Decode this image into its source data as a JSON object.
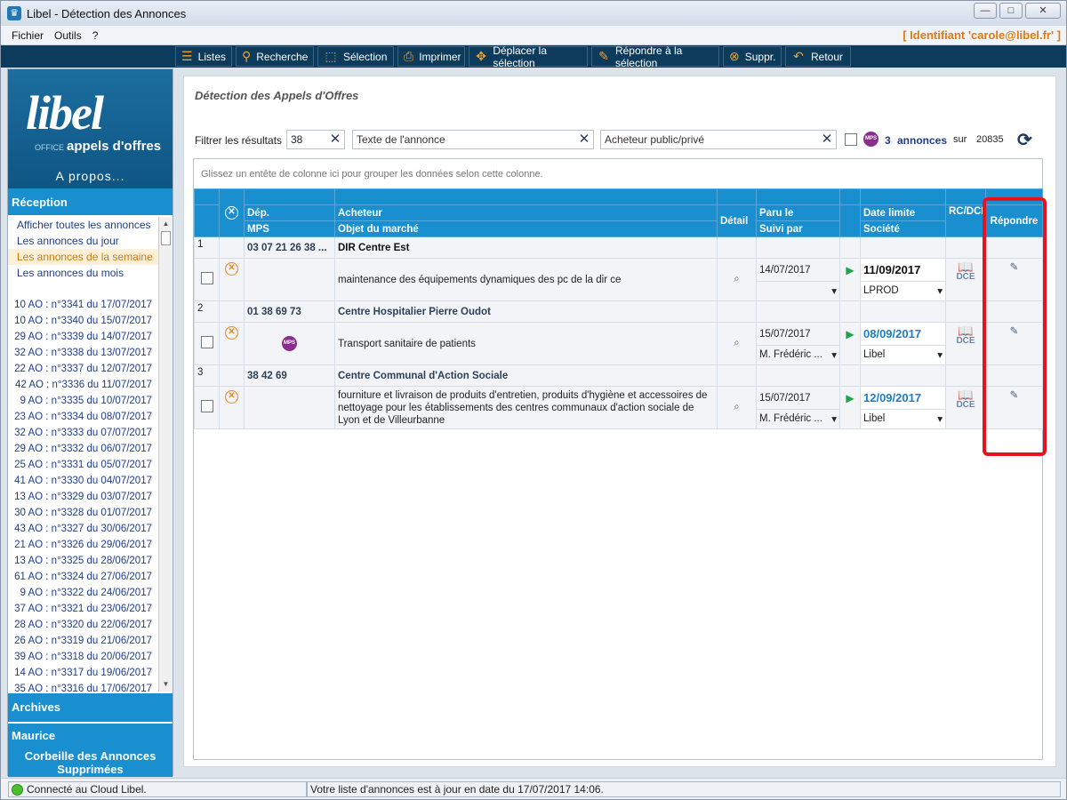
{
  "window": {
    "title": "Libel - Détection des Annonces",
    "controls": {
      "minimize": "—",
      "maximize": "□",
      "close": "✕"
    }
  },
  "menu": {
    "items": [
      "Fichier",
      "Outils",
      "?"
    ],
    "identity": "[ Identifiant 'carole@libel.fr' ]"
  },
  "toolbar": {
    "buttons": [
      {
        "label": "Listes",
        "icon": "list-icon"
      },
      {
        "label": "Recherche",
        "icon": "search-icon"
      },
      {
        "label": "Sélection",
        "icon": "selection-icon"
      },
      {
        "label": "Imprimer",
        "icon": "printer-icon"
      },
      {
        "label": "Déplacer la sélection",
        "icon": "move-icon"
      },
      {
        "label": "Répondre à la sélection",
        "icon": "edit-icon"
      },
      {
        "label": "Suppr.",
        "icon": "cancel-icon"
      },
      {
        "label": "Retour",
        "icon": "back-icon"
      }
    ]
  },
  "sidebar": {
    "logo": {
      "word": "libel",
      "office": "OFFICE",
      "sub": "appels d'offres"
    },
    "apropos": "A propos...",
    "reception": "Réception",
    "nav": [
      "Afficher toutes les annonces",
      "Les annonces du jour",
      "Les annonces de la semaine",
      "Les annonces du mois"
    ],
    "ao": [
      "10 AO : n°3341 du 17/07/2017",
      "10 AO : n°3340 du 15/07/2017",
      "29 AO : n°3339 du 14/07/2017",
      "32 AO : n°3338 du 13/07/2017",
      "22 AO : n°3337 du 12/07/2017",
      "42 AO : n°3336 du 11/07/2017",
      "9 AO : n°3335 du 10/07/2017",
      "23 AO : n°3334 du 08/07/2017",
      "32 AO : n°3333 du 07/07/2017",
      "29 AO : n°3332 du 06/07/2017",
      "25 AO : n°3331 du 05/07/2017",
      "41 AO : n°3330 du 04/07/2017",
      "13 AO : n°3329 du 03/07/2017",
      "30 AO : n°3328 du 01/07/2017",
      "43 AO : n°3327 du 30/06/2017",
      "21 AO : n°3326 du 29/06/2017",
      "13 AO : n°3325 du 28/06/2017",
      "61 AO : n°3324 du 27/06/2017",
      "9 AO : n°3322 du 24/06/2017",
      "37 AO : n°3321 du 23/06/2017",
      "28 AO : n°3320 du 22/06/2017",
      "26 AO : n°3319 du 21/06/2017",
      "39 AO : n°3318 du 20/06/2017",
      "14 AO : n°3317 du 19/06/2017",
      "35 AO : n°3316 du 17/06/2017"
    ],
    "archives": "Archives",
    "maurice": "Maurice",
    "corbeille": "Corbeille des Annonces Supprimées"
  },
  "main": {
    "title": "Détection des Appels d'Offres",
    "filter_label": "Filtrer les résultats",
    "filter_dep": "38",
    "filter_text": "Texte de l'annonce",
    "filter_buyer": "Acheteur public/privé",
    "mps_label": "MPS",
    "count": "3",
    "count_label": "annonces",
    "sur": "sur",
    "total": "20835",
    "group_hint": "Glissez un entête de colonne ici pour grouper les données selon cette colonne."
  },
  "grid": {
    "headers": {
      "dep": "Dép.",
      "mps": "MPS",
      "acheteur": "Acheteur",
      "objet": "Objet du marché",
      "detail": "Détail",
      "paru": "Paru le",
      "suivi": "Suivi par",
      "date_limite": "Date limite",
      "societe": "Société",
      "rcdce": "RC/DCE",
      "repondre": "Répondre"
    },
    "rows": [
      {
        "num": "1",
        "dep": "03 07 21 26 38 ...",
        "acheteur": "DIR Centre Est",
        "objet": "maintenance des équipements dynamiques des pc de la dir ce",
        "paru": "14/07/2017",
        "suivi": "",
        "date_limite": "11/09/2017",
        "date_color": "#111111",
        "societe": "LPROD",
        "mps": ""
      },
      {
        "num": "2",
        "dep": "01 38 69 73",
        "acheteur": "Centre Hospitalier Pierre Oudot",
        "objet": "Transport sanitaire de patients",
        "paru": "15/07/2017",
        "suivi": "M. Frédéric ...",
        "date_limite": "08/09/2017",
        "date_color": "#1a7ec3",
        "societe": "Libel",
        "mps": "MPS"
      },
      {
        "num": "3",
        "dep": "38 42 69",
        "acheteur": "Centre Communal d'Action Sociale",
        "objet": "fourniture et livraison de produits d'entretien, produits d'hygiène et accessoires de nettoyage pour les établissements des centres communaux d'action sociale de Lyon et de Villeurbanne",
        "paru": "15/07/2017",
        "suivi": "M. Frédéric ...",
        "date_limite": "12/09/2017",
        "date_color": "#1a7ec3",
        "societe": "Libel",
        "mps": ""
      }
    ],
    "dce_label": "DCE"
  },
  "status": {
    "left": "Connecté au Cloud Libel.",
    "right": "Votre liste d'annonces est à jour en date du 17/07/2017 14:06."
  },
  "colors": {
    "accent": "#1a8fcf",
    "toolbar": "#0d3b5c",
    "highlight": "#e8121e",
    "orange": "#e8891b"
  }
}
